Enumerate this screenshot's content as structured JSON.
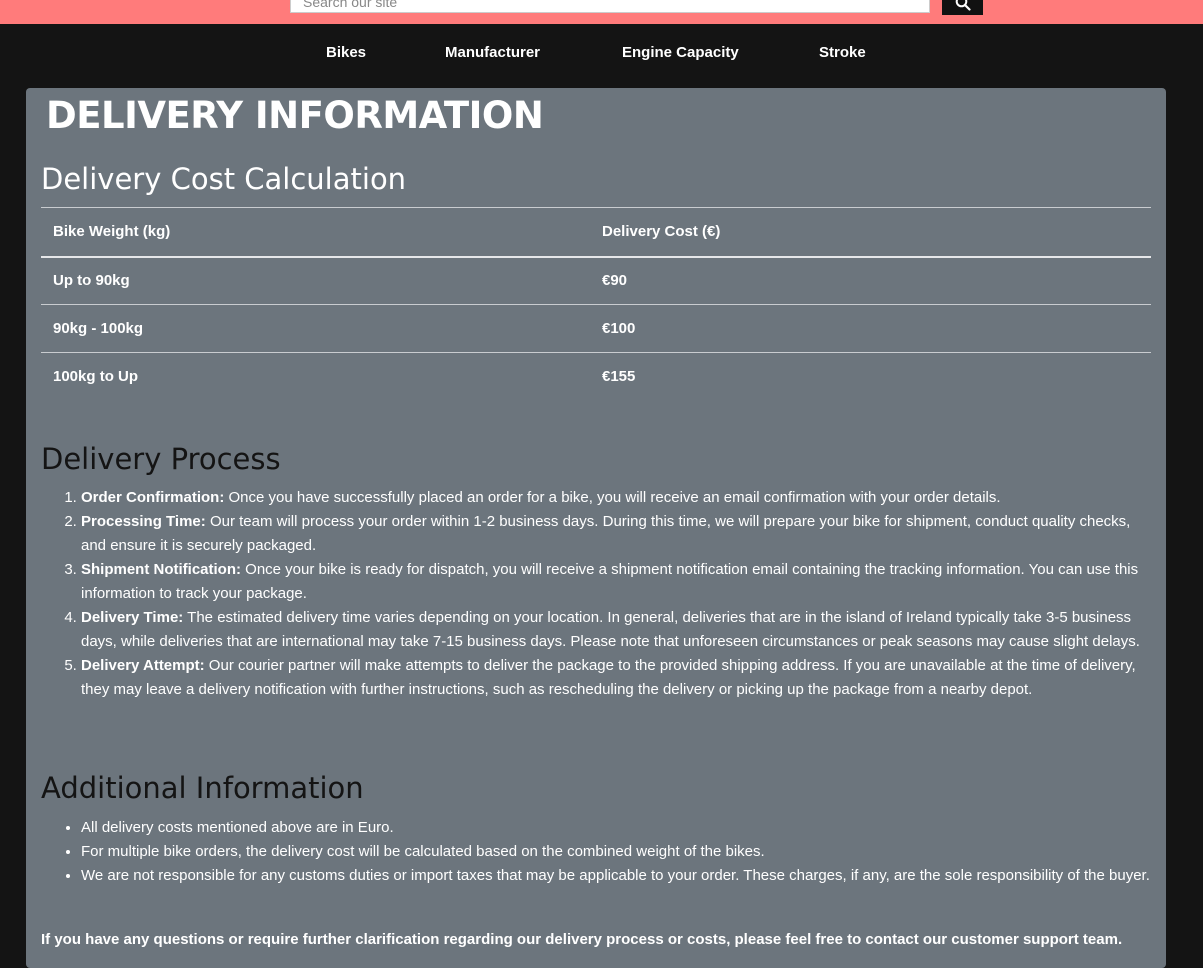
{
  "search": {
    "placeholder": "Search our site",
    "button_icon": "search-icon"
  },
  "nav": {
    "items": [
      {
        "label": "Bikes"
      },
      {
        "label": "Manufacturer"
      },
      {
        "label": "Engine Capacity"
      },
      {
        "label": "Stroke"
      }
    ]
  },
  "page": {
    "title": "DELIVERY INFORMATION"
  },
  "cost_section": {
    "heading": "Delivery Cost Calculation",
    "columns": [
      "Bike Weight (kg)",
      "Delivery Cost (€)"
    ],
    "rows": [
      [
        "Up to 90kg",
        "€90"
      ],
      [
        "90kg - 100kg",
        "€100"
      ],
      [
        "100kg to Up",
        "€155"
      ]
    ]
  },
  "process_section": {
    "heading": "Delivery Process",
    "steps": [
      {
        "title": "Order Confirmation:",
        "text": " Once you have successfully placed an order for a bike, you will receive an email confirmation with your order details."
      },
      {
        "title": "Processing Time:",
        "text": " Our team will process your order within 1-2 business days. During this time, we will prepare your bike for shipment, conduct quality checks, and ensure it is securely packaged."
      },
      {
        "title": "Shipment Notification:",
        "text": " Once your bike is ready for dispatch, you will receive a shipment notification email containing the tracking information. You can use this information to track your package."
      },
      {
        "title": "Delivery Time:",
        "text": " The estimated delivery time varies depending on your location. In general, deliveries that are in the island of Ireland typically take 3-5 business days, while deliveries that are international may take 7-15 business days. Please note that unforeseen circumstances or peak seasons may cause slight delays."
      },
      {
        "title": "Delivery Attempt:",
        "text": " Our courier partner will make attempts to deliver the package to the provided shipping address. If you are unavailable at the time of delivery, they may leave a delivery notification with further instructions, such as rescheduling the delivery or picking up the package from a nearby depot."
      }
    ]
  },
  "additional_section": {
    "heading": "Additional Information",
    "items": [
      "All delivery costs mentioned above are in Euro.",
      "For multiple bike orders, the delivery cost will be calculated based on the combined weight of the bikes.",
      "We are not responsible for any customs duties or import taxes that may be applicable to your order. These charges, if any, are the sole responsibility of the buyer."
    ]
  },
  "footer_note": "If you have any questions or require further clarification regarding our delivery process or costs, please feel free to contact our customer support team.",
  "colors": {
    "topbar": "#ff7b7b",
    "nav_bg": "#141414",
    "panel_bg": "#6c757d"
  }
}
